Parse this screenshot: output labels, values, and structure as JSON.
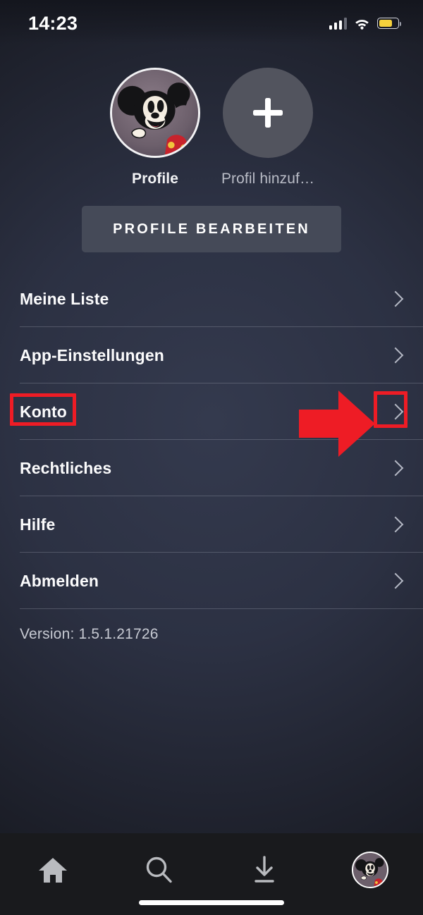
{
  "status_bar": {
    "time": "14:23",
    "signal_icon": "cellular-signal-icon",
    "wifi_icon": "wifi-icon",
    "battery_icon": "battery-icon",
    "battery_color": "#f5d13c",
    "battery_level_percent": 72
  },
  "profiles": {
    "items": [
      {
        "label": "Profile",
        "avatar": "mickey-mouse-avatar",
        "selected": true
      },
      {
        "label": "Profil hinzuf…",
        "avatar": "add-profile-plus-icon",
        "selected": false
      }
    ],
    "edit_button_label": "PROFILE BEARBEITEN"
  },
  "menu": {
    "items": [
      {
        "label": "Meine Liste",
        "chevron": "chevron-right-icon"
      },
      {
        "label": "App-Einstellungen",
        "chevron": "chevron-right-icon"
      },
      {
        "label": "Konto",
        "chevron": "chevron-right-icon",
        "highlighted": true
      },
      {
        "label": "Rechtliches",
        "chevron": "chevron-right-icon"
      },
      {
        "label": "Hilfe",
        "chevron": "chevron-right-icon"
      },
      {
        "label": "Abmelden",
        "chevron": "chevron-right-icon"
      }
    ],
    "version_text": "Version: 1.5.1.21726"
  },
  "annotations": {
    "color": "#ee1c25",
    "highlight_label_target": "Konto",
    "arrow_icon": "right-arrow-annotation",
    "boxes": [
      "konto-label-highlight",
      "konto-chevron-highlight"
    ]
  },
  "tab_bar": {
    "items": [
      {
        "name": "home",
        "icon": "home-icon",
        "active": false
      },
      {
        "name": "search",
        "icon": "search-icon",
        "active": false
      },
      {
        "name": "downloads",
        "icon": "download-icon",
        "active": false
      },
      {
        "name": "profile",
        "icon": "mickey-mouse-avatar",
        "active": true
      }
    ]
  },
  "colors": {
    "background_top": "#2b3042",
    "background_edge": "#16181f",
    "tabbar_background": "#191a1d",
    "accent_red": "#ee1c25",
    "button_gray": "#454a58",
    "add_circle_gray": "#52545e"
  }
}
